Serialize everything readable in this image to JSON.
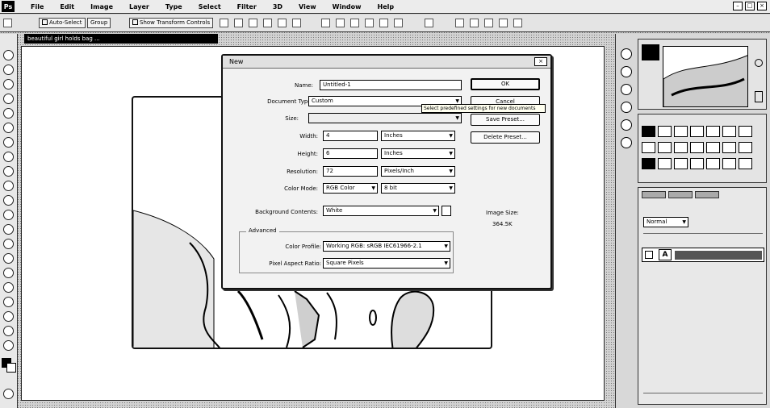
{
  "app": {
    "logo": "Ps",
    "menu": [
      "File",
      "Edit",
      "Image",
      "Layer",
      "Type",
      "Select",
      "Filter",
      "3D",
      "View",
      "Window",
      "Help"
    ],
    "window_buttons": [
      "–",
      "□",
      "×"
    ]
  },
  "options_bar": {
    "auto_select": "Auto-Select",
    "auto_select_target": "Group",
    "show_transform": "Show Transform Controls"
  },
  "document_tab": "beautiful girl holds bag ...",
  "dialog": {
    "title": "New",
    "close": "×",
    "name_label": "Name:",
    "name_value": "Untitled-1",
    "doc_type_label": "Document Type:",
    "doc_type_value": "Custom",
    "size_label": "Size:",
    "size_value": "",
    "width_label": "Width:",
    "width_value": "4",
    "width_unit": "Inches",
    "height_label": "Height:",
    "height_value": "6",
    "height_unit": "Inches",
    "resolution_label": "Resolution:",
    "resolution_value": "72",
    "resolution_unit": "Pixels/Inch",
    "color_mode_label": "Color Mode:",
    "color_mode_value": "RGB Color",
    "bit_depth": "8 bit",
    "background_label": "Background Contents:",
    "background_value": "White",
    "advanced_label": "Advanced",
    "color_profile_label": "Color Profile:",
    "color_profile_value": "Working RGB: sRGB IEC61966-2.1",
    "pixel_aspect_label": "Pixel Aspect Ratio:",
    "pixel_aspect_value": "Square Pixels",
    "ok": "OK",
    "cancel": "Cancel",
    "save_preset": "Save Preset...",
    "delete_preset": "Delete Preset...",
    "image_size_label": "Image Size:",
    "image_size_value": "364.5K",
    "tooltip": "Select predefined settings for new documents"
  },
  "panels": {
    "layers_mode": "Normal",
    "layer_thumb_char": "A"
  }
}
